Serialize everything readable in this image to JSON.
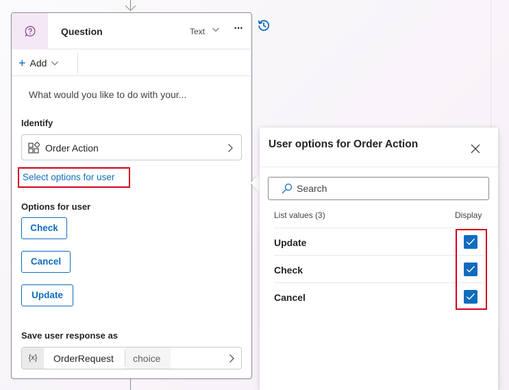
{
  "card": {
    "title": "Question",
    "type_label": "Text",
    "more_label": "···",
    "add_label": "Add",
    "prompt": "What would you like to do with your...",
    "identify_label": "Identify",
    "entity": "Order Action",
    "select_options_link": "Select options for user",
    "options_label": "Options for user",
    "options": [
      "Check",
      "Cancel",
      "Update"
    ],
    "save_label": "Save user response as",
    "variable": {
      "token": "{x}",
      "name": "OrderRequest",
      "type": "choice"
    }
  },
  "panel": {
    "title": "User options for Order Action",
    "search_placeholder": "Search",
    "list_header": "List values (3)",
    "display_header": "Display",
    "items": [
      {
        "label": "Update",
        "checked": true
      },
      {
        "label": "Check",
        "checked": true
      },
      {
        "label": "Cancel",
        "checked": true
      }
    ]
  },
  "colors": {
    "accent": "#0f6cbd",
    "highlight": "#d0021b",
    "question_icon_bg": "#f4e8f6"
  },
  "icons": [
    "question-icon",
    "chevron-down-icon",
    "more-icon",
    "plus-icon",
    "entity-icon",
    "chevron-right-icon",
    "variable-icon",
    "history-icon",
    "close-icon",
    "search-icon",
    "checkmark-icon"
  ]
}
